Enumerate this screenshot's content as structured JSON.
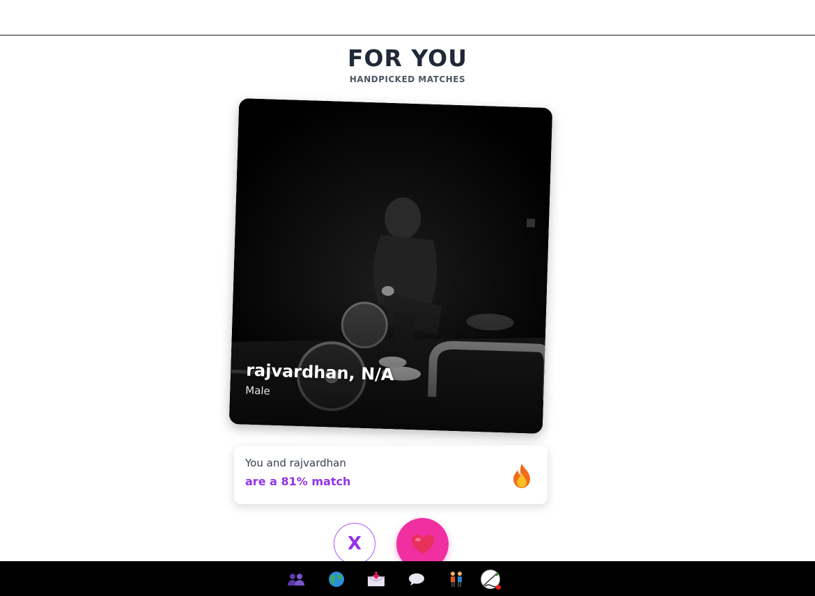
{
  "header": {
    "title": "FOR YOU",
    "subtitle": "HANDPICKED MATCHES"
  },
  "card": {
    "name": "rajvardhan, N/A",
    "gender": "Male"
  },
  "match": {
    "line1": "You and rajvardhan",
    "line2": "are a 81% match",
    "icon": "fire-icon"
  },
  "actions": {
    "dislike_label": "X",
    "like_icon": "heart-icon"
  },
  "nav": {
    "items": [
      "people-icon",
      "globe-icon",
      "inbox-icon",
      "chat-bubble-icon",
      "couple-icon",
      "avatar"
    ]
  },
  "colors": {
    "accent_purple": "#9333ea",
    "like_pink": "#f02fa0",
    "nav_bg": "#000000"
  }
}
